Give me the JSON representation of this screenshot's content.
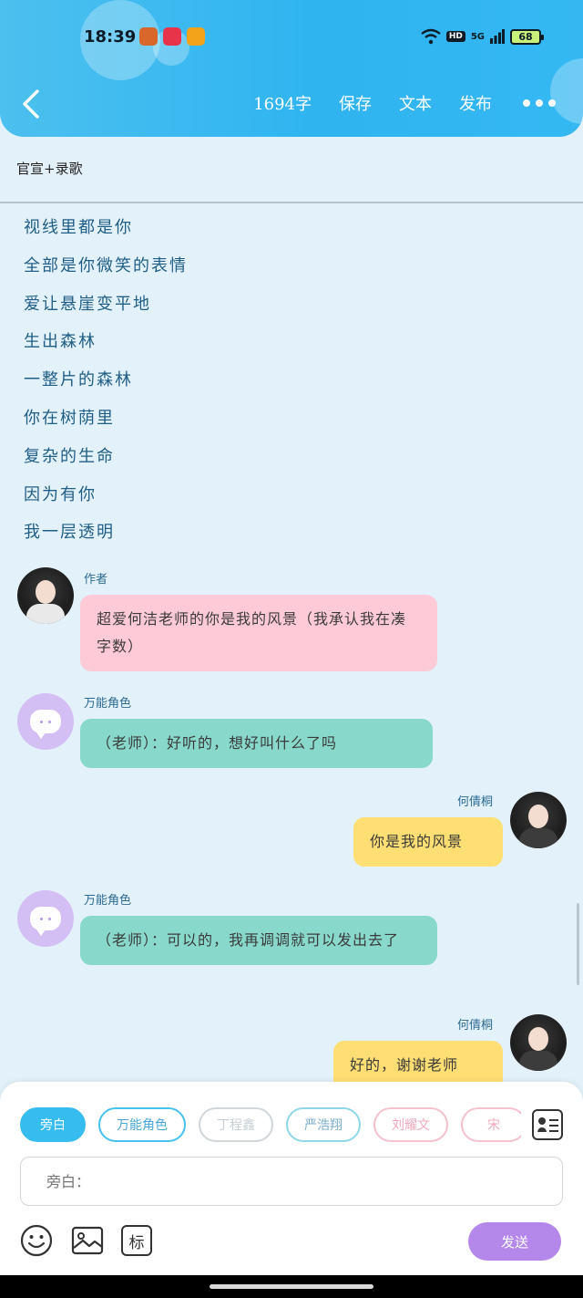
{
  "status_bar": {
    "time": "18:39",
    "network": "5G",
    "hd": "HD",
    "battery": "68"
  },
  "header": {
    "word_count": "1694字",
    "save_label": "保存",
    "text_label": "文本",
    "publish_label": "发布"
  },
  "title": "官宣+录歌",
  "lyrics": [
    "视线里都是你",
    "全部是你微笑的表情",
    "爱让悬崖变平地",
    "生出森林",
    "一整片的森林",
    "你在树荫里",
    "复杂的生命",
    "因为有你",
    "我一层透明"
  ],
  "messages": [
    {
      "sender": "作者",
      "text": "超爱何洁老师的你是我的风景（我承认我在凑字数）"
    },
    {
      "sender": "万能角色",
      "text": "（老师）：好听的，想好叫什么了吗"
    },
    {
      "sender": "何倩桐",
      "text": "你是我的风景"
    },
    {
      "sender": "万能角色",
      "text": "（老师）：可以的，我再调调就可以发出去了"
    },
    {
      "sender": "何倩桐",
      "text": "好的，谢谢老师"
    }
  ],
  "roles": [
    "旁白",
    "万能角色",
    "丁程鑫",
    "严浩翔",
    "刘耀文",
    "宋"
  ],
  "input": {
    "placeholder": "旁白："
  },
  "tools": {
    "mark_label": "标"
  },
  "send_label": "发送",
  "colors": {
    "header": "#2fb4f0",
    "pink_bubble": "#ffcad8",
    "green_bubble": "#88d9cc",
    "yellow_bubble": "#ffdf73",
    "send": "#b487ea"
  }
}
